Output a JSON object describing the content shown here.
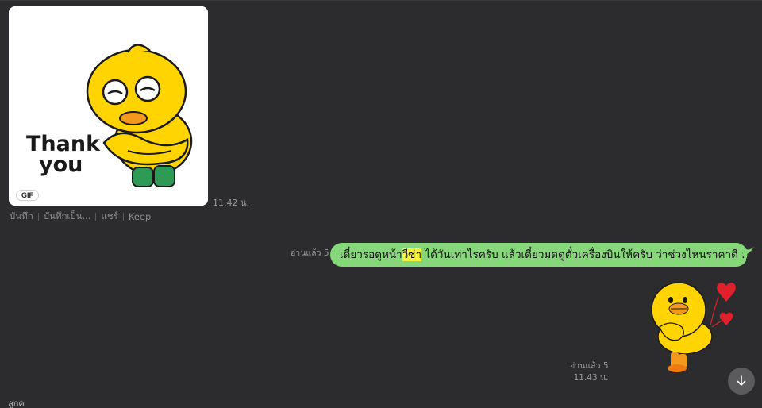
{
  "incoming": {
    "gif_badge": "GIF",
    "gif_text_line1": "Thank",
    "gif_text_line2": "you",
    "time": "11.42 น.",
    "actions": [
      "บันทึก",
      "บันทึกเป็น...",
      "แชร์",
      "Keep"
    ]
  },
  "outgoing_text": {
    "read_status": "อ่านแล้ว 5",
    "text_before": "เดี๋ยวรอดูหน้า",
    "text_highlight": "วีซ่า",
    "text_after": " ได้วันเท่าไรครับ แล้วเดี๋ยวมดดูตั๋วเครื่องบินให้ครับ ว่าช่วงไหนราคาดี :)",
    "bubble_color": "#86d67a",
    "highlight_color": "#f6f23a"
  },
  "outgoing_sticker": {
    "read_status": "อ่านแล้ว 5",
    "time": "11.43 น."
  },
  "scroll_button_icon": "arrow-down-icon",
  "bottom_partial_text": "ลูกค",
  "colors": {
    "background": "#2c2c2e",
    "duck_yellow": "#ffd400",
    "duck_outline": "#1a1a1a",
    "beak_orange": "#f39a1e",
    "heart_red": "#e0202a"
  }
}
